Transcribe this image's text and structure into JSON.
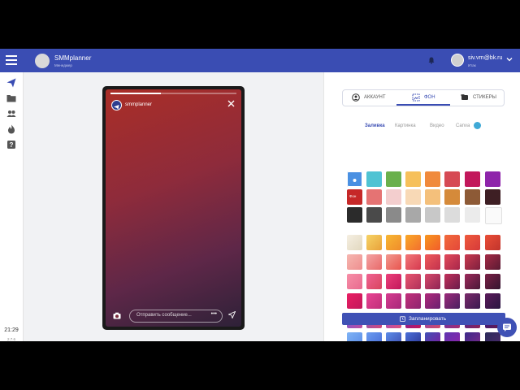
{
  "header": {
    "project_name": "SMMplanner",
    "project_sub": "Менеджер",
    "user_email": "siv.vrn@bk.ru",
    "user_role": "Итак"
  },
  "sidebar": {
    "time": "21:29",
    "version": "2.7.6",
    "items": [
      "send-icon",
      "folder-icon",
      "users-icon",
      "fire-icon",
      "help-icon"
    ]
  },
  "story": {
    "account": "smmplanner",
    "progress": 0.4,
    "reply_placeholder": "Отправить сообщение...",
    "reply_more": "•••"
  },
  "editor": {
    "tabs": [
      {
        "label": "АККАУНТ",
        "icon": "account-icon"
      },
      {
        "label": "ФОН",
        "icon": "background-icon"
      },
      {
        "label": "СТИКЕРЫ",
        "icon": "sticker-icon"
      }
    ],
    "active_tab": "ФОН",
    "subtabs": [
      "Заливка",
      "Картинка",
      "Видео",
      "Canva"
    ],
    "active_subtab": "Заливка",
    "canva_badge": "",
    "swatch_label": "Фон",
    "schedule_label": "Запланировать",
    "solid_colors": [
      [
        "#4a90e2",
        "#4fc3d3",
        "#6ab04c",
        "#f6c05a",
        "#f08a3c",
        "#d64a54",
        "#c2185b",
        "#8e24aa"
      ],
      [
        "#c62828",
        "#e57373",
        "#f3cece",
        "#f8d9b6",
        "#f4c07b",
        "#d58a3a",
        "#8d5a36",
        "#3e1f24"
      ],
      [
        "#2b2b2b",
        "#4a4a4a",
        "#8a8a8a",
        "#a8a8a8",
        "#c8c8c8",
        "#dcdcdc",
        "#ebebeb",
        "#fafafa"
      ]
    ],
    "gradients": [
      [
        "#f5efe2,#e2d8bf",
        "#f6d365,#e9a23b",
        "#f7b733,#f08c2b",
        "#f9a826,#f36f2f",
        "#f7971e,#f25c2b",
        "#f26a3b,#e4483a",
        "#ef5a3c,#d63a3a",
        "#e94e37,#c2342c"
      ],
      [
        "#f6b6b0,#ee8f8f",
        "#f4a3a3,#e86a6a",
        "#f2998f,#e8554f",
        "#f27777,#d63a4f",
        "#ef5a5a,#c2314d",
        "#e24a5a,#a8264a",
        "#ca3a4f,#7e1f3e",
        "#a52a45,#5a1a33"
      ],
      [
        "#f78fa7,#e86a8f",
        "#f06292,#d8455f",
        "#ec407a,#c2185b",
        "#e8556f,#b0305a",
        "#d84a6a,#8e2454",
        "#c2305a,#6a1b4a",
        "#9c2a5a,#4a1838",
        "#7a2045,#351530"
      ],
      [
        "#e91e63,#c2185b",
        "#e84393,#c0307a",
        "#d63c8f,#a8287a",
        "#c2307a,#8e2470",
        "#b02a7a,#6a2070",
        "#9c2a7a,#4a2060",
        "#7a2a6a,#3a1a50",
        "#5a1a5a,#2a1540"
      ],
      [
        "#6a5adf,#c24d9c",
        "#7e57c2,#d5497a",
        "#9c4dcc,#e0507a",
        "#7b1fa2,#c2185b",
        "#8e44ad,#d04a6a",
        "#5e35b1,#a72d6f",
        "#4527a0,#8e2454",
        "#311b92,#6a1b4a"
      ],
      [
        "#7fb3f5,#5c8de8",
        "#6a9bf0,#4a6fd8",
        "#5c8de8,#3f51b5",
        "#4a6fd8,#2e3a9a",
        "#3f51b5,#7b1fa2",
        "#5e35b1,#8e24aa",
        "#3a2a8a,#7a2a8a",
        "#2a2a5a,#4a2a6a"
      ]
    ]
  },
  "colors": {
    "brand": "#3a4db3",
    "button": "#3f51b5",
    "badge": "#3fa9d6"
  }
}
